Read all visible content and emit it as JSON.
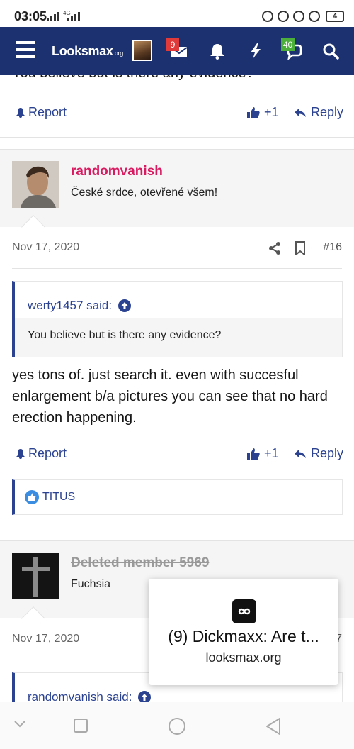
{
  "status_bar": {
    "time": "03:05",
    "network": "4G",
    "battery": "4"
  },
  "header": {
    "logo_text": "Looksmax",
    "logo_suffix": ".org",
    "messages_badge": "9",
    "alerts_badge": "40",
    "colors": {
      "bar": "#1b3170",
      "messages_badge": "#e03a3a",
      "alerts_badge": "#4caf3a"
    }
  },
  "prev_post": {
    "cut_text": "You believe but is there any evidence?",
    "report_label": "Report",
    "like_count": "+1",
    "reply_label": "Reply"
  },
  "post16": {
    "username": "randomvanish",
    "user_title": "České srdce, otevřené všem!",
    "date": "Nov 17, 2020",
    "number": "#16",
    "quote_author": "werty1457 said:",
    "quote_text": "You believe but is there any evidence?",
    "body": "yes tons of. just search it. even with succesful enlargement b/a pictures you can see that no hard erection happening.",
    "report_label": "Report",
    "like_count": "+1",
    "reply_label": "Reply",
    "reaction_user": "TITUS",
    "colors": {
      "username": "#d81b60"
    }
  },
  "post17": {
    "username": "Deleted member 5969",
    "user_title": "Fuchsia",
    "date": "Nov 17, 2020",
    "number_partial": "7",
    "quote_author": "randomvanish said:"
  },
  "popup": {
    "title": "(9) Dickmaxx: Are t...",
    "site": "looksmax.org"
  }
}
